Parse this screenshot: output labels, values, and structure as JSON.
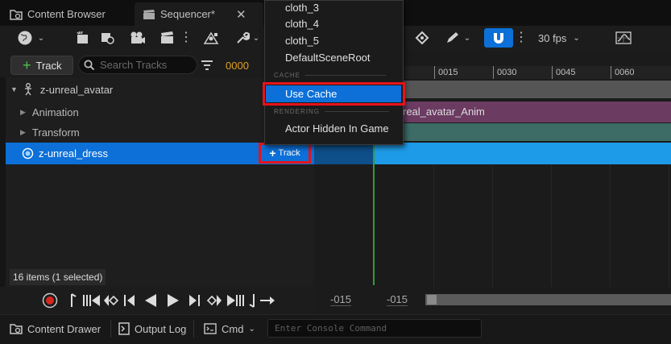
{
  "tabs": [
    {
      "label": "Content Browser",
      "active": false
    },
    {
      "label": "Sequencer*",
      "active": true
    }
  ],
  "toolbar": {
    "fps_label": "30 fps"
  },
  "filter": {
    "add_track_label": "Track",
    "search_placeholder": "Search Tracks",
    "frame_value": "0000"
  },
  "outliner": {
    "rows": [
      {
        "label": "z-unreal_avatar"
      },
      {
        "label": "Animation"
      },
      {
        "label": "Transform"
      },
      {
        "label": "z-unreal_dress",
        "add_track_label": "Track"
      }
    ],
    "status": "16 items (1 selected)"
  },
  "timeline": {
    "ticks": [
      "0015",
      "0030",
      "0045",
      "0060"
    ],
    "anim_section_label": "real_avatar_Anim",
    "range_start": "-015",
    "range_end": "-015"
  },
  "menu": {
    "items_top": [
      "cloth_3",
      "cloth_4",
      "cloth_5",
      "DefaultSceneRoot"
    ],
    "section_cache": "CACHE",
    "use_cache": "Use Cache",
    "section_rendering": "RENDERING",
    "actor_hidden": "Actor Hidden In Game"
  },
  "bottom": {
    "content_drawer": "Content Drawer",
    "output_log": "Output Log",
    "cmd": "Cmd",
    "console_placeholder": "Enter Console Command"
  },
  "colors": {
    "selection": "#0c70d8",
    "accent_blue": "#0c70d8",
    "highlight_red": "#e8121a",
    "anim_track": "#6b3b62",
    "transform_track": "#3d6b66",
    "dress_track": "#1e8fd8"
  }
}
